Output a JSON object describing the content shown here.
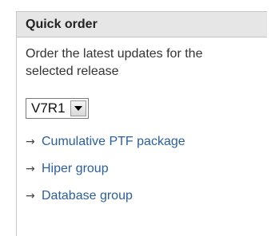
{
  "panel": {
    "title": "Quick order",
    "description": "Order the latest updates for the selected release",
    "release_select": {
      "selected": "V7R1"
    },
    "links": [
      {
        "arrow": "→",
        "label": "Cumulative PTF package"
      },
      {
        "arrow": "→",
        "label": "Hiper group"
      },
      {
        "arrow": "→",
        "label": "Database group"
      }
    ]
  },
  "colors": {
    "header_bg": "#e6e6e6",
    "link": "#2a5f9e",
    "border": "#c8c8c8"
  }
}
